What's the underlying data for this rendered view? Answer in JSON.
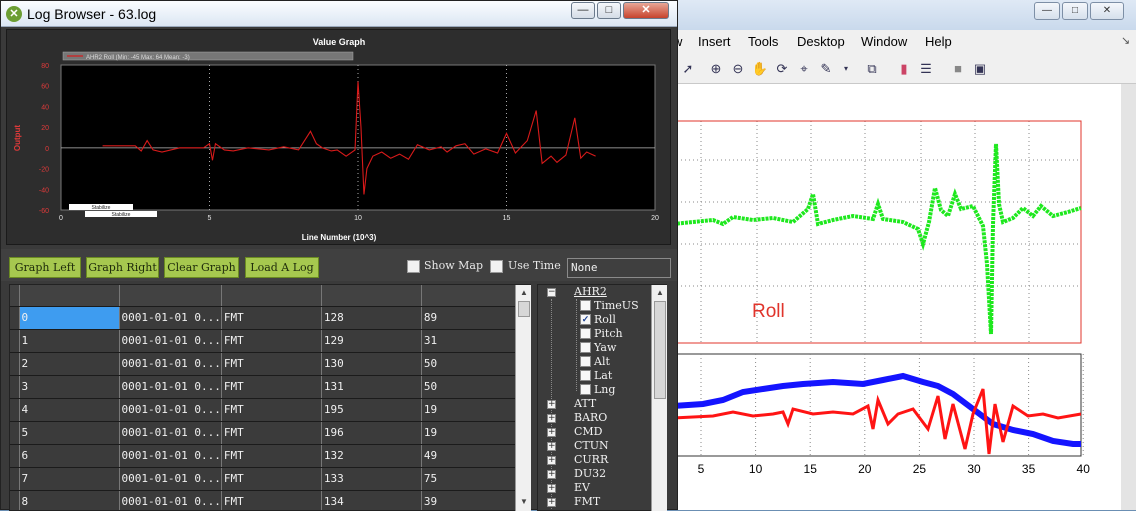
{
  "figure_window": {
    "menu": [
      "w",
      "Insert",
      "Tools",
      "Desktop",
      "Window",
      "Help"
    ],
    "toolbar_icons": [
      "arrow-pointer-icon",
      "zoom-in-icon",
      "zoom-out-icon",
      "pan-hand-icon",
      "rotate-3d-icon",
      "data-cursor-icon",
      "brush-icon",
      "link-plot-icon",
      "insert-colorbar-icon",
      "insert-legend-icon",
      "hide-plot-tools-icon",
      "show-plot-tools-icon"
    ],
    "window_buttons": [
      "minimize",
      "restore",
      "close"
    ],
    "upper_axes": {
      "legend_text": "Roll",
      "legend_color": "#e0342b",
      "series_color": "#1ee81e"
    },
    "lower_axes": {
      "x_ticks": [
        "5",
        "10",
        "15",
        "20",
        "25",
        "30",
        "35",
        "40"
      ],
      "series_colors": [
        "#1414ff",
        "#ff1414"
      ]
    }
  },
  "log_browser": {
    "title": "Log Browser - 63.log",
    "window_buttons": {
      "minimize": "—",
      "restore": "□",
      "close": "✕"
    },
    "buttons": {
      "graph_left": "Graph Left",
      "graph_right": "Graph Right",
      "clear_graph": "Clear Graph",
      "load_log": "Load A Log"
    },
    "show_map": {
      "label": "Show Map",
      "checked": false
    },
    "use_time": {
      "label": "Use Time",
      "checked": false
    },
    "type_select": {
      "value": "None"
    },
    "grid": {
      "columns": [
        "",
        "",
        "",
        "",
        ""
      ],
      "rows": [
        [
          "0",
          "0001-01-01 0...",
          "FMT",
          "128",
          "89"
        ],
        [
          "1",
          "0001-01-01 0...",
          "FMT",
          "129",
          "31"
        ],
        [
          "2",
          "0001-01-01 0...",
          "FMT",
          "130",
          "50"
        ],
        [
          "3",
          "0001-01-01 0...",
          "FMT",
          "131",
          "50"
        ],
        [
          "4",
          "0001-01-01 0...",
          "FMT",
          "195",
          "19"
        ],
        [
          "5",
          "0001-01-01 0...",
          "FMT",
          "196",
          "19"
        ],
        [
          "6",
          "0001-01-01 0...",
          "FMT",
          "132",
          "49"
        ],
        [
          "7",
          "0001-01-01 0...",
          "FMT",
          "133",
          "75"
        ],
        [
          "8",
          "0001-01-01 0...",
          "FMT",
          "134",
          "39"
        ]
      ]
    },
    "tree": {
      "expanded": {
        "label": "AHR2",
        "children": [
          {
            "label": "TimeUS",
            "checked": false
          },
          {
            "label": "Roll",
            "checked": true
          },
          {
            "label": "Pitch",
            "checked": false
          },
          {
            "label": "Yaw",
            "checked": false
          },
          {
            "label": "Alt",
            "checked": false
          },
          {
            "label": "Lat",
            "checked": false
          },
          {
            "label": "Lng",
            "checked": false
          }
        ]
      },
      "collapsed": [
        "ATT",
        "BARO",
        "CMD",
        "CTUN",
        "CURR",
        "DU32",
        "EV",
        "FMT"
      ]
    },
    "value_graph": {
      "chart_data": {
        "type": "line",
        "title": "Value Graph",
        "xlabel": "Line Number (10^3)",
        "ylabel": "Output",
        "xlim": [
          0,
          20
        ],
        "ylim": [
          -60,
          80
        ],
        "x_ticks": [
          0,
          5,
          10,
          15,
          20
        ],
        "y_ticks": [
          80,
          60,
          40,
          20,
          0,
          -20,
          -40,
          -60
        ],
        "grid": true,
        "legend_position": "top-left",
        "mode_labels": [
          "Stabilize",
          "Stabilize"
        ],
        "series": [
          {
            "name": "AHR2 Roll (Min: -45 Max: 64 Mean: -3)",
            "color": "#d81a1a",
            "x": [
              1.4,
              2.5,
              2.7,
              2.9,
              3.1,
              3.4,
              4.0,
              4.8,
              5.0,
              5.1,
              5.2,
              5.5,
              5.8,
              6.3,
              7.0,
              7.5,
              8.0,
              8.4,
              8.6,
              8.8,
              9.1,
              9.3,
              9.6,
              9.9,
              10.0,
              10.1,
              10.2,
              10.3,
              10.5,
              10.8,
              11.1,
              11.4,
              11.7,
              12.0,
              12.4,
              12.8,
              13.0,
              13.3,
              13.6,
              13.9,
              14.3,
              14.7,
              15.0,
              15.3,
              15.7,
              16.0,
              16.2,
              16.5,
              16.7,
              17.0,
              17.3,
              17.5,
              17.7,
              18.0
            ],
            "y": [
              2,
              2,
              -3,
              7,
              -2,
              -4,
              0,
              0,
              4,
              -12,
              4,
              -2,
              -3,
              0,
              -2,
              1,
              -2,
              16,
              4,
              0,
              -3,
              -2,
              -8,
              -2,
              64,
              20,
              -45,
              -20,
              -8,
              -4,
              -10,
              -6,
              -11,
              3,
              -2,
              1,
              -4,
              2,
              4,
              -6,
              -1,
              -5,
              14,
              -5,
              7,
              36,
              -15,
              -8,
              -14,
              -7,
              29,
              -10,
              -4,
              -8
            ]
          }
        ]
      }
    }
  }
}
